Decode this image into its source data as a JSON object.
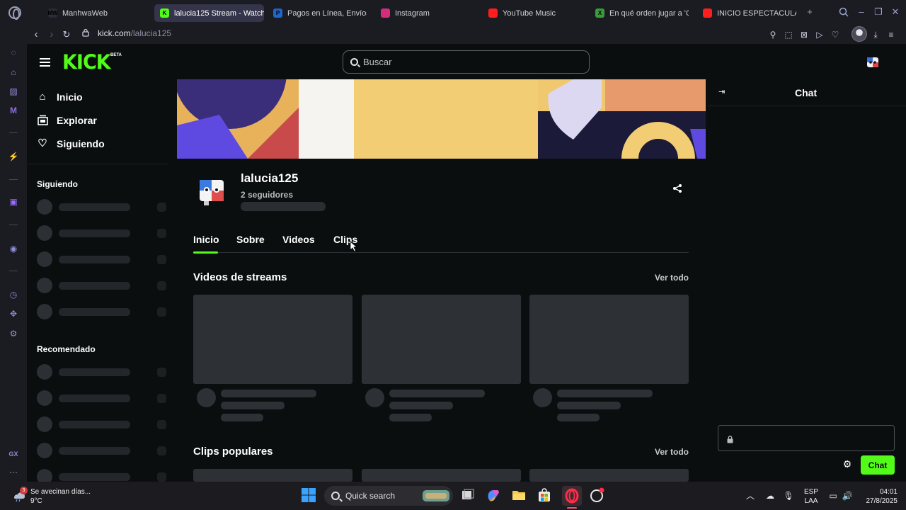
{
  "browser": {
    "tabs": [
      {
        "label": "ManhwaWeb",
        "icon": "manhwaweb-favicon",
        "favicon_text": "MW",
        "color": "#2a2a3a",
        "active": false
      },
      {
        "label": "lalucia125 Stream - Watch",
        "icon": "kick-favicon",
        "favicon_text": "K",
        "color": "#53fc18",
        "active": true
      },
      {
        "label": "Pagos en Línea, Envíos",
        "icon": "paypal-favicon",
        "favicon_text": "P",
        "color": "#1e66c9",
        "active": false
      },
      {
        "label": "Instagram",
        "icon": "instagram-favicon",
        "favicon_text": "",
        "color": "#d62d7b",
        "active": false
      },
      {
        "label": "YouTube Music",
        "icon": "youtube-music-favicon",
        "favicon_text": "",
        "color": "#ff1e1e",
        "active": false
      },
      {
        "label": "En qué orden jugar a 'G",
        "icon": "xbox-favicon",
        "favicon_text": "X",
        "color": "#3a9b3a",
        "active": false
      },
      {
        "label": "INICIO ESPECTACULAR",
        "icon": "youtube-favicon",
        "favicon_text": "",
        "color": "#ff1e1e",
        "active": false
      }
    ],
    "url_host": "kick.com",
    "url_path": "/lalucia125"
  },
  "kick": {
    "logo": "KICK",
    "beta": "BETA",
    "search_placeholder": "Buscar",
    "nav": [
      {
        "label": "Inicio",
        "icon": "home-icon"
      },
      {
        "label": "Explorar",
        "icon": "browse-icon"
      },
      {
        "label": "Siguiendo",
        "icon": "heart-icon"
      }
    ],
    "following_title": "Siguiendo",
    "recommended_title": "Recomendado",
    "channel": {
      "name": "lalucia125",
      "followers": "2 seguidores"
    },
    "tabs": [
      "Inicio",
      "Sobre",
      "Videos",
      "Clips"
    ],
    "active_tab": "Inicio",
    "sections": {
      "videos_title": "Videos de streams",
      "clips_title": "Clips populares",
      "see_all": "Ver todo"
    },
    "chat": {
      "title": "Chat",
      "send_label": "Chat"
    },
    "brand_color": "#53fc18"
  },
  "taskbar": {
    "weather_text": "Se avecinan días...",
    "weather_temp": "9°C",
    "weather_badge": "3",
    "search_label": "Quick search",
    "lang_top": "ESP",
    "lang_bottom": "LAA",
    "time": "04:01",
    "date": "27/8/2025"
  }
}
